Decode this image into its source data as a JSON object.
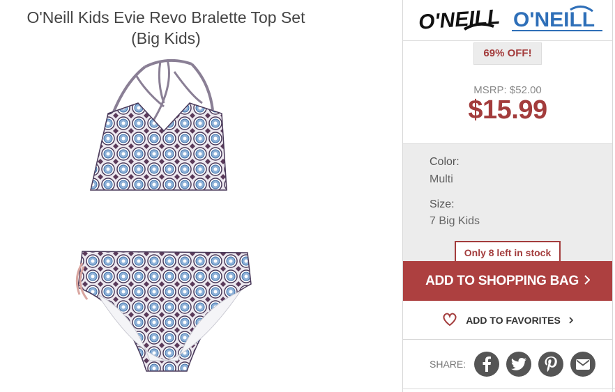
{
  "product": {
    "title": "O'Neill Kids Evie Revo Bralette Top Set (Big Kids)",
    "brand_logo_a": "O'NEILL",
    "brand_logo_b": "O'NEILL"
  },
  "pricing": {
    "discount": "69% OFF!",
    "msrp": "MSRP: $52.00",
    "price": "$15.99"
  },
  "options": {
    "color_label": "Color:",
    "color_value": "Multi",
    "size_label": "Size:",
    "size_value": "7 Big Kids"
  },
  "stock": "Only 8 left in stock",
  "actions": {
    "add_to_bag": "ADD TO SHOPPING BAG",
    "add_to_favorites": "ADD TO FAVORITES"
  },
  "share": {
    "label": "SHARE:",
    "networks": [
      "facebook-icon",
      "twitter-icon",
      "pinterest-icon",
      "email-icon"
    ]
  },
  "colors": {
    "accent": "#ad4040",
    "panel_gray": "#ececec"
  }
}
